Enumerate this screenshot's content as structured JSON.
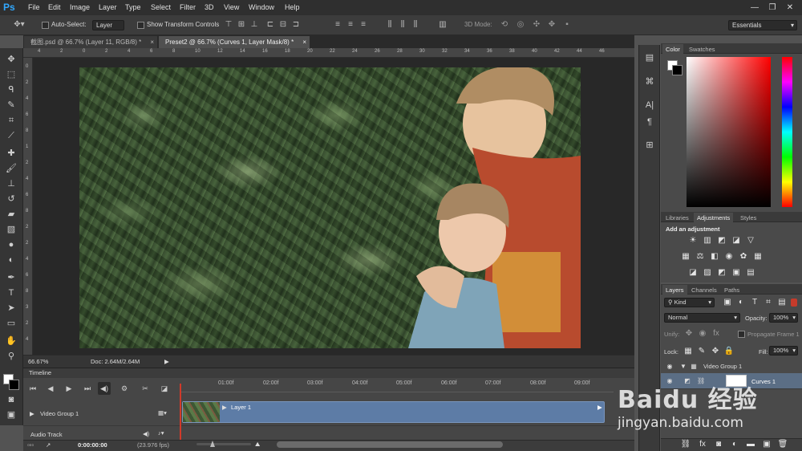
{
  "app": {
    "logo": "Ps"
  },
  "menu": [
    "File",
    "Edit",
    "Image",
    "Layer",
    "Type",
    "Select",
    "Filter",
    "3D",
    "View",
    "Window",
    "Help"
  ],
  "window_controls": {
    "minimize": "—",
    "restore": "❐",
    "close": "✕"
  },
  "options": {
    "auto_select_label": "Auto-Select:",
    "auto_select_value": "Layer",
    "show_transform_label": "Show Transform Controls",
    "mode_3d_label": "3D Mode:",
    "workspace": "Essentials"
  },
  "doc_tabs": [
    {
      "label": "截图.psd @ 66.7% (Layer 11, RGB/8) *",
      "close": "×"
    },
    {
      "label": "Preset2 @ 66.7% (Curves 1, Layer Mask/8) *",
      "close": "×"
    }
  ],
  "ruler_h": [
    "4",
    "2",
    "0",
    "2",
    "4",
    "6",
    "8",
    "10",
    "12",
    "14",
    "16",
    "18",
    "20",
    "22",
    "24",
    "26",
    "28",
    "30",
    "32",
    "34",
    "36",
    "38",
    "40",
    "42",
    "44",
    "46"
  ],
  "ruler_v": [
    "0",
    "2",
    "4",
    "6",
    "8",
    "1",
    "2",
    "4",
    "6",
    "8",
    "2",
    "2",
    "4",
    "6",
    "8",
    "3",
    "2",
    "4"
  ],
  "status": {
    "zoom": "66.67%",
    "doc": "Doc: 2.64M/2.64M"
  },
  "timeline": {
    "title": "Timeline",
    "ticks": [
      "01:00f",
      "02:00f",
      "03:00f",
      "04:00f",
      "05:00f",
      "06:00f",
      "07:00f",
      "08:00f",
      "09:00f"
    ],
    "video_group": "Video Group 1",
    "clip_label": "Layer 1",
    "audio_track": "Audio Track",
    "timecode": "0:00:00:00",
    "fps": "(23.976 fps)"
  },
  "color_panel": {
    "tabs": [
      "Color",
      "Swatches"
    ]
  },
  "adjustments_panel": {
    "tabs": [
      "Libraries",
      "Adjustments",
      "Styles"
    ],
    "heading": "Add an adjustment"
  },
  "layers_panel": {
    "tabs": [
      "Layers",
      "Channels",
      "Paths"
    ],
    "kind": "Kind",
    "blend_mode": "Normal",
    "opacity_label": "Opacity:",
    "opacity_value": "100%",
    "unify_label": "Unify:",
    "propagate_label": "Propagate Frame 1",
    "lock_label": "Lock:",
    "fill_label": "Fill:",
    "fill_value": "100%",
    "layers": [
      "Video Group 1",
      "Curves 1"
    ]
  },
  "watermark": {
    "logo": "Baidu 经验",
    "url": "jingyan.baidu.com"
  }
}
